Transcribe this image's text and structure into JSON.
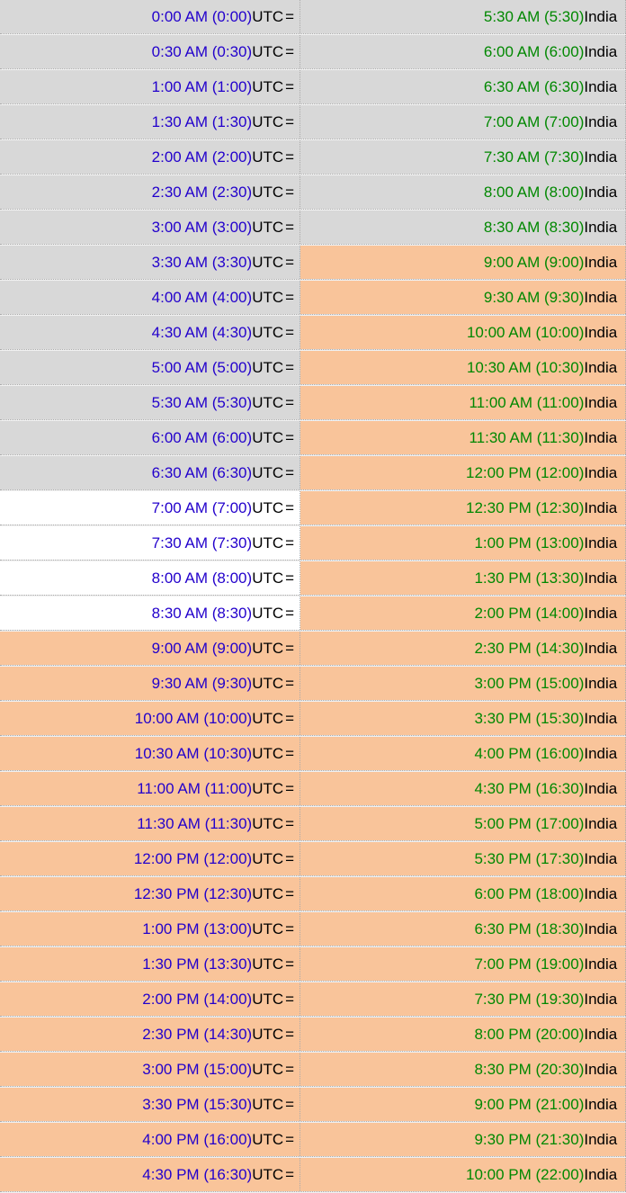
{
  "leftTz": "UTC",
  "rightTz": "India",
  "rows": [
    {
      "lt": "0:00 AM (0:00)",
      "rt": "5:30 AM (5:30)",
      "lb": "gray",
      "rb": "gray"
    },
    {
      "lt": "0:30 AM (0:30)",
      "rt": "6:00 AM (6:00)",
      "lb": "gray",
      "rb": "gray"
    },
    {
      "lt": "1:00 AM (1:00)",
      "rt": "6:30 AM (6:30)",
      "lb": "gray",
      "rb": "gray"
    },
    {
      "lt": "1:30 AM (1:30)",
      "rt": "7:00 AM (7:00)",
      "lb": "gray",
      "rb": "gray"
    },
    {
      "lt": "2:00 AM (2:00)",
      "rt": "7:30 AM (7:30)",
      "lb": "gray",
      "rb": "gray"
    },
    {
      "lt": "2:30 AM (2:30)",
      "rt": "8:00 AM (8:00)",
      "lb": "gray",
      "rb": "gray"
    },
    {
      "lt": "3:00 AM (3:00)",
      "rt": "8:30 AM (8:30)",
      "lb": "gray",
      "rb": "gray"
    },
    {
      "lt": "3:30 AM (3:30)",
      "rt": "9:00 AM (9:00)",
      "lb": "gray",
      "rb": "orange"
    },
    {
      "lt": "4:00 AM (4:00)",
      "rt": "9:30 AM (9:30)",
      "lb": "gray",
      "rb": "orange"
    },
    {
      "lt": "4:30 AM (4:30)",
      "rt": "10:00 AM (10:00)",
      "lb": "gray",
      "rb": "orange"
    },
    {
      "lt": "5:00 AM (5:00)",
      "rt": "10:30 AM (10:30)",
      "lb": "gray",
      "rb": "orange"
    },
    {
      "lt": "5:30 AM (5:30)",
      "rt": "11:00 AM (11:00)",
      "lb": "gray",
      "rb": "orange"
    },
    {
      "lt": "6:00 AM (6:00)",
      "rt": "11:30 AM (11:30)",
      "lb": "gray",
      "rb": "orange"
    },
    {
      "lt": "6:30 AM (6:30)",
      "rt": "12:00 PM (12:00)",
      "lb": "gray",
      "rb": "orange"
    },
    {
      "lt": "7:00 AM (7:00)",
      "rt": "12:30 PM (12:30)",
      "lb": "white",
      "rb": "orange"
    },
    {
      "lt": "7:30 AM (7:30)",
      "rt": "1:00 PM (13:00)",
      "lb": "white",
      "rb": "orange"
    },
    {
      "lt": "8:00 AM (8:00)",
      "rt": "1:30 PM (13:30)",
      "lb": "white",
      "rb": "orange"
    },
    {
      "lt": "8:30 AM (8:30)",
      "rt": "2:00 PM (14:00)",
      "lb": "white",
      "rb": "orange"
    },
    {
      "lt": "9:00 AM (9:00)",
      "rt": "2:30 PM (14:30)",
      "lb": "orange",
      "rb": "orange"
    },
    {
      "lt": "9:30 AM (9:30)",
      "rt": "3:00 PM (15:00)",
      "lb": "orange",
      "rb": "orange"
    },
    {
      "lt": "10:00 AM (10:00)",
      "rt": "3:30 PM (15:30)",
      "lb": "orange",
      "rb": "orange"
    },
    {
      "lt": "10:30 AM (10:30)",
      "rt": "4:00 PM (16:00)",
      "lb": "orange",
      "rb": "orange"
    },
    {
      "lt": "11:00 AM (11:00)",
      "rt": "4:30 PM (16:30)",
      "lb": "orange",
      "rb": "orange"
    },
    {
      "lt": "11:30 AM (11:30)",
      "rt": "5:00 PM (17:00)",
      "lb": "orange",
      "rb": "orange"
    },
    {
      "lt": "12:00 PM (12:00)",
      "rt": "5:30 PM (17:30)",
      "lb": "orange",
      "rb": "orange"
    },
    {
      "lt": "12:30 PM (12:30)",
      "rt": "6:00 PM (18:00)",
      "lb": "orange",
      "rb": "orange"
    },
    {
      "lt": "1:00 PM (13:00)",
      "rt": "6:30 PM (18:30)",
      "lb": "orange",
      "rb": "orange"
    },
    {
      "lt": "1:30 PM (13:30)",
      "rt": "7:00 PM (19:00)",
      "lb": "orange",
      "rb": "orange"
    },
    {
      "lt": "2:00 PM (14:00)",
      "rt": "7:30 PM (19:30)",
      "lb": "orange",
      "rb": "orange"
    },
    {
      "lt": "2:30 PM (14:30)",
      "rt": "8:00 PM (20:00)",
      "lb": "orange",
      "rb": "orange"
    },
    {
      "lt": "3:00 PM (15:00)",
      "rt": "8:30 PM (20:30)",
      "lb": "orange",
      "rb": "orange"
    },
    {
      "lt": "3:30 PM (15:30)",
      "rt": "9:00 PM (21:00)",
      "lb": "orange",
      "rb": "orange"
    },
    {
      "lt": "4:00 PM (16:00)",
      "rt": "9:30 PM (21:30)",
      "lb": "orange",
      "rb": "orange"
    },
    {
      "lt": "4:30 PM (16:30)",
      "rt": "10:00 PM (22:00)",
      "lb": "orange",
      "rb": "orange"
    }
  ]
}
